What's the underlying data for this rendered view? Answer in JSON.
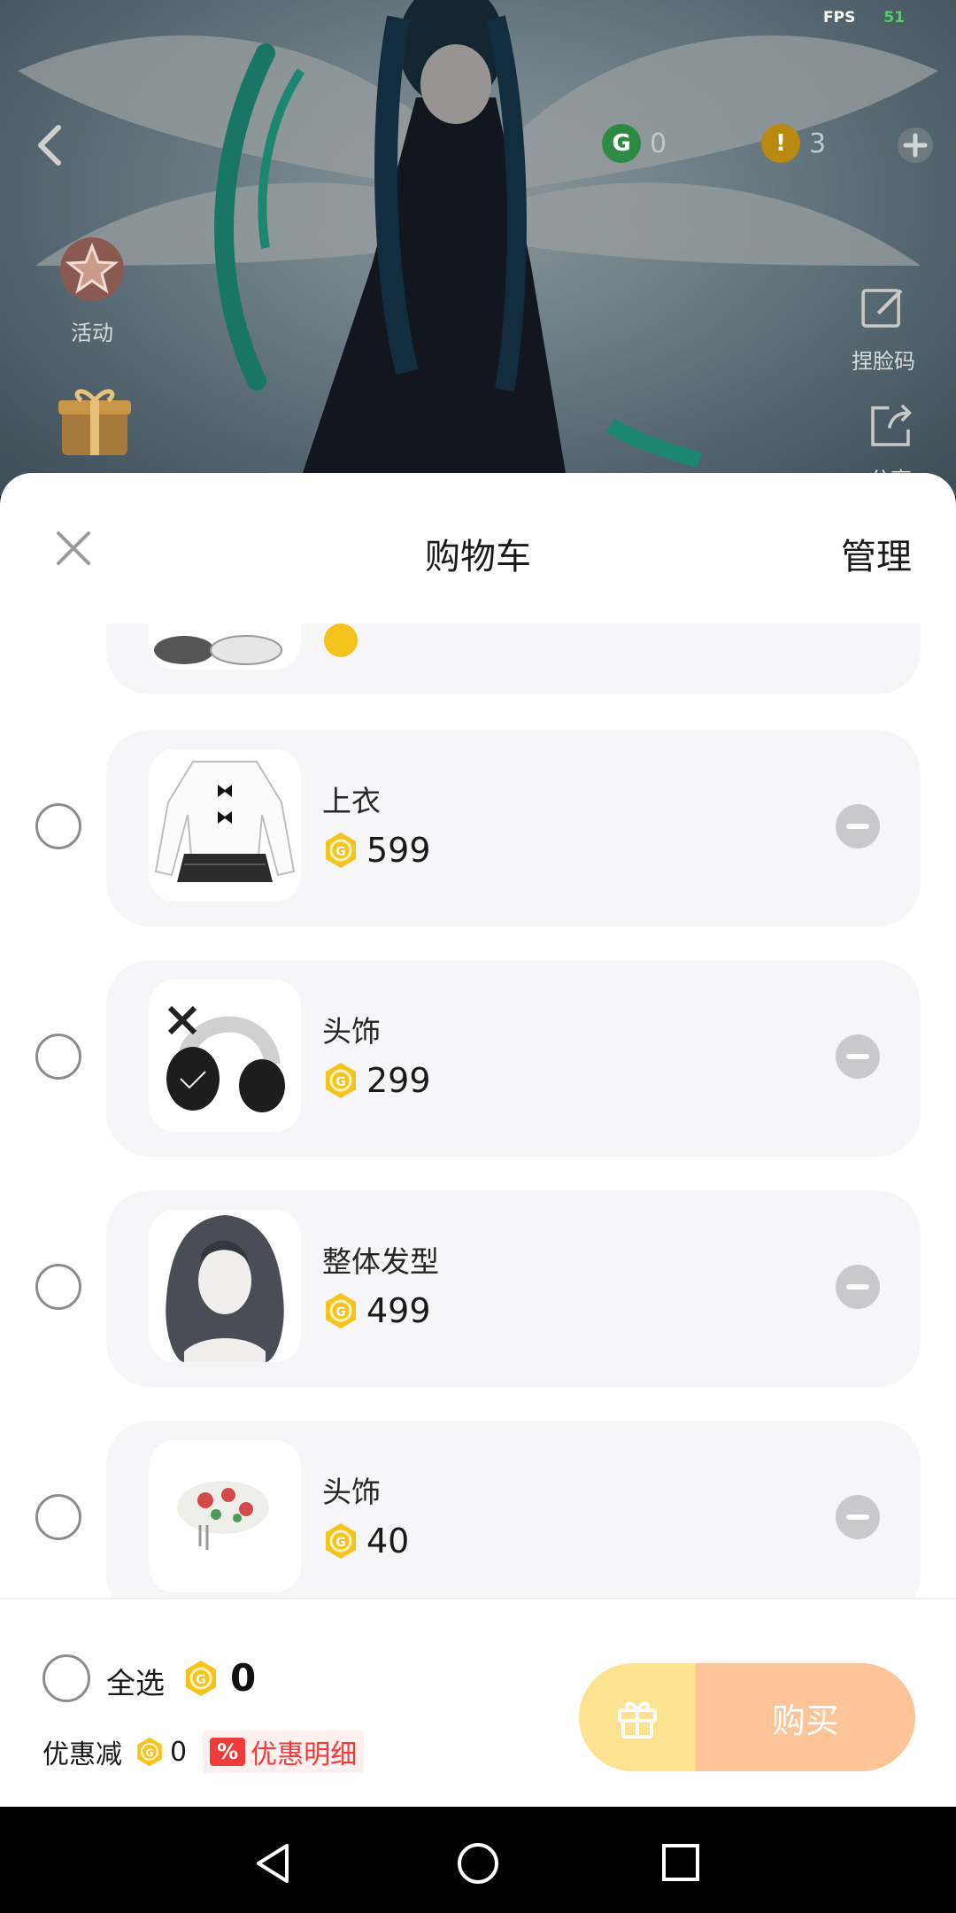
{
  "game": {
    "fps_label": "FPS",
    "fps_value": "51",
    "coin_g_value": "0",
    "coin_o_value": "3",
    "activity_label": "活动",
    "face_code_label": "捏脸码",
    "share_label": "分享"
  },
  "cart": {
    "title": "购物车",
    "manage_label": "管理",
    "items": [
      {
        "name": "上衣",
        "price": "599"
      },
      {
        "name": "头饰",
        "price": "299"
      },
      {
        "name": "整体发型",
        "price": "499"
      },
      {
        "name": "头饰",
        "price": "40"
      }
    ],
    "select_all_label": "全选",
    "total_value": "0",
    "discount_label": "优惠减",
    "discount_value": "0",
    "discount_badge": "%",
    "discount_detail_label": "优惠明细",
    "buy_label": "购买"
  },
  "colors": {
    "coin_gold": "#f6c21c",
    "buy_orange": "#fdc497",
    "gift_yellow": "#fde38f",
    "accent_red": "#f03b3b"
  }
}
